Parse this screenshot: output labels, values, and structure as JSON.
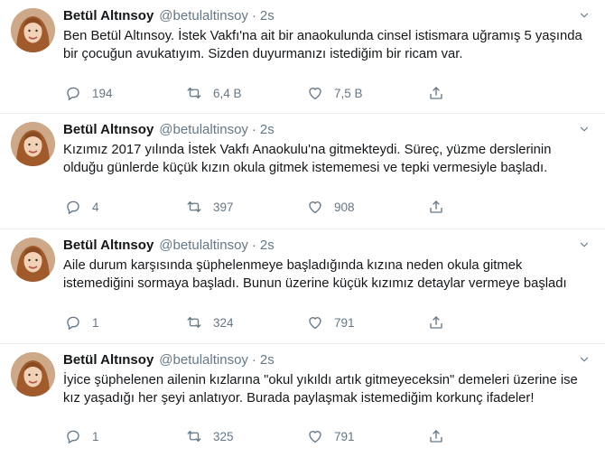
{
  "colors": {
    "text": "#14171a",
    "muted": "#657786",
    "divider": "#e6ecf0"
  },
  "tweets": [
    {
      "name": "Betül Altınsoy",
      "handle": "@betulaltinsoy",
      "separator": "·",
      "time": "2s",
      "text": "Ben Betül Altınsoy.  İstek Vakfı'na ait bir anaokulunda cinsel istismara uğramış 5 yaşında bir çocuğun avukatıyım. Sizden duyurmanızı istediğim bir ricam var.",
      "replies": "194",
      "retweets": "6,4 B",
      "likes": "7,5 B"
    },
    {
      "name": "Betül Altınsoy",
      "handle": "@betulaltinsoy",
      "separator": "·",
      "time": "2s",
      "text": "Kızımız 2017 yılında İstek Vakfı Anaokulu'na gitmekteydi. Süreç, yüzme derslerinin olduğu günlerde küçük kızın okula gitmek istememesi ve tepki vermesiyle başladı.",
      "replies": "4",
      "retweets": "397",
      "likes": "908"
    },
    {
      "name": "Betül Altınsoy",
      "handle": "@betulaltinsoy",
      "separator": "·",
      "time": "2s",
      "text": "Aile durum karşısında şüphelenmeye başladığında kızına neden okula gitmek istemediğini sormaya başladı. Bunun üzerine küçük kızımız detaylar vermeye başladı",
      "replies": "1",
      "retweets": "324",
      "likes": "791"
    },
    {
      "name": "Betül Altınsoy",
      "handle": "@betulaltinsoy",
      "separator": "·",
      "time": "2s",
      "text": "İyice şüphelenen ailenin kızlarına \"okul yıkıldı artık gitmeyeceksin\" demeleri üzerine ise kız yaşadığı her şeyi anlatıyor. Burada paylaşmak istemediğim korkunç ifadeler!",
      "replies": "1",
      "retweets": "325",
      "likes": "791"
    }
  ]
}
